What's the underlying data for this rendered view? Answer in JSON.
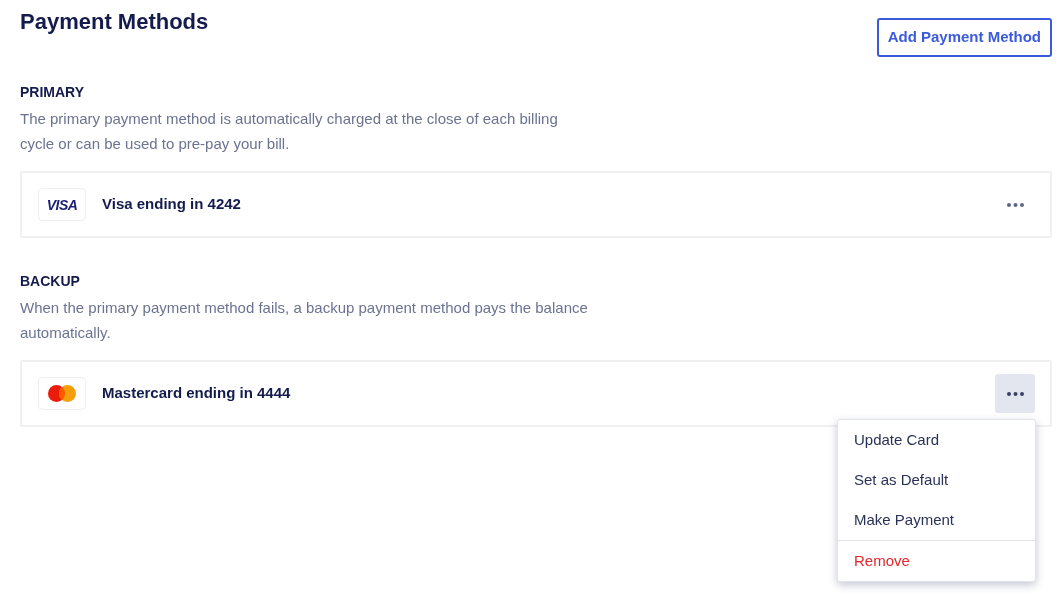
{
  "page": {
    "title": "Payment Methods",
    "add_button": "Add Payment Method"
  },
  "sections": [
    {
      "heading": "PRIMARY",
      "description": "The primary payment method is automatically charged at the close of each billing cycle or can be used to pre-pay your bill.",
      "card": {
        "kind": "visa",
        "logo_text": "VISA",
        "label": "Visa ending in 4242",
        "menu_open": false
      }
    },
    {
      "heading": "BACKUP",
      "description": "When the primary payment method fails, a backup payment method pays the balance automatically.",
      "card": {
        "kind": "mastercard",
        "label": "Mastercard ending in 4444",
        "menu_open": true,
        "menu_items": [
          {
            "label": "Update Card",
            "kind": "action"
          },
          {
            "label": "Set as Default",
            "kind": "action"
          },
          {
            "label": "Make Payment",
            "kind": "action"
          },
          {
            "label": "Remove",
            "kind": "danger"
          }
        ]
      }
    }
  ]
}
